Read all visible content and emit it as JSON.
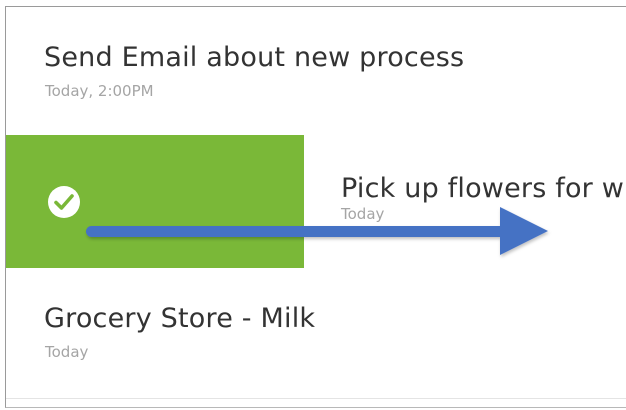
{
  "tasks": [
    {
      "title": "Send Email about new process",
      "time": "Today, 2:00PM"
    },
    {
      "title": "Pick up flowers for wi",
      "time": "Today",
      "status": "completed"
    },
    {
      "title": "Grocery Store - Milk",
      "time": "Today"
    }
  ],
  "colors": {
    "complete_green": "#7ab838",
    "arrow_blue": "#4472c4"
  },
  "icons": {
    "complete": "check-circle-icon",
    "gesture": "swipe-right-arrow-icon"
  }
}
